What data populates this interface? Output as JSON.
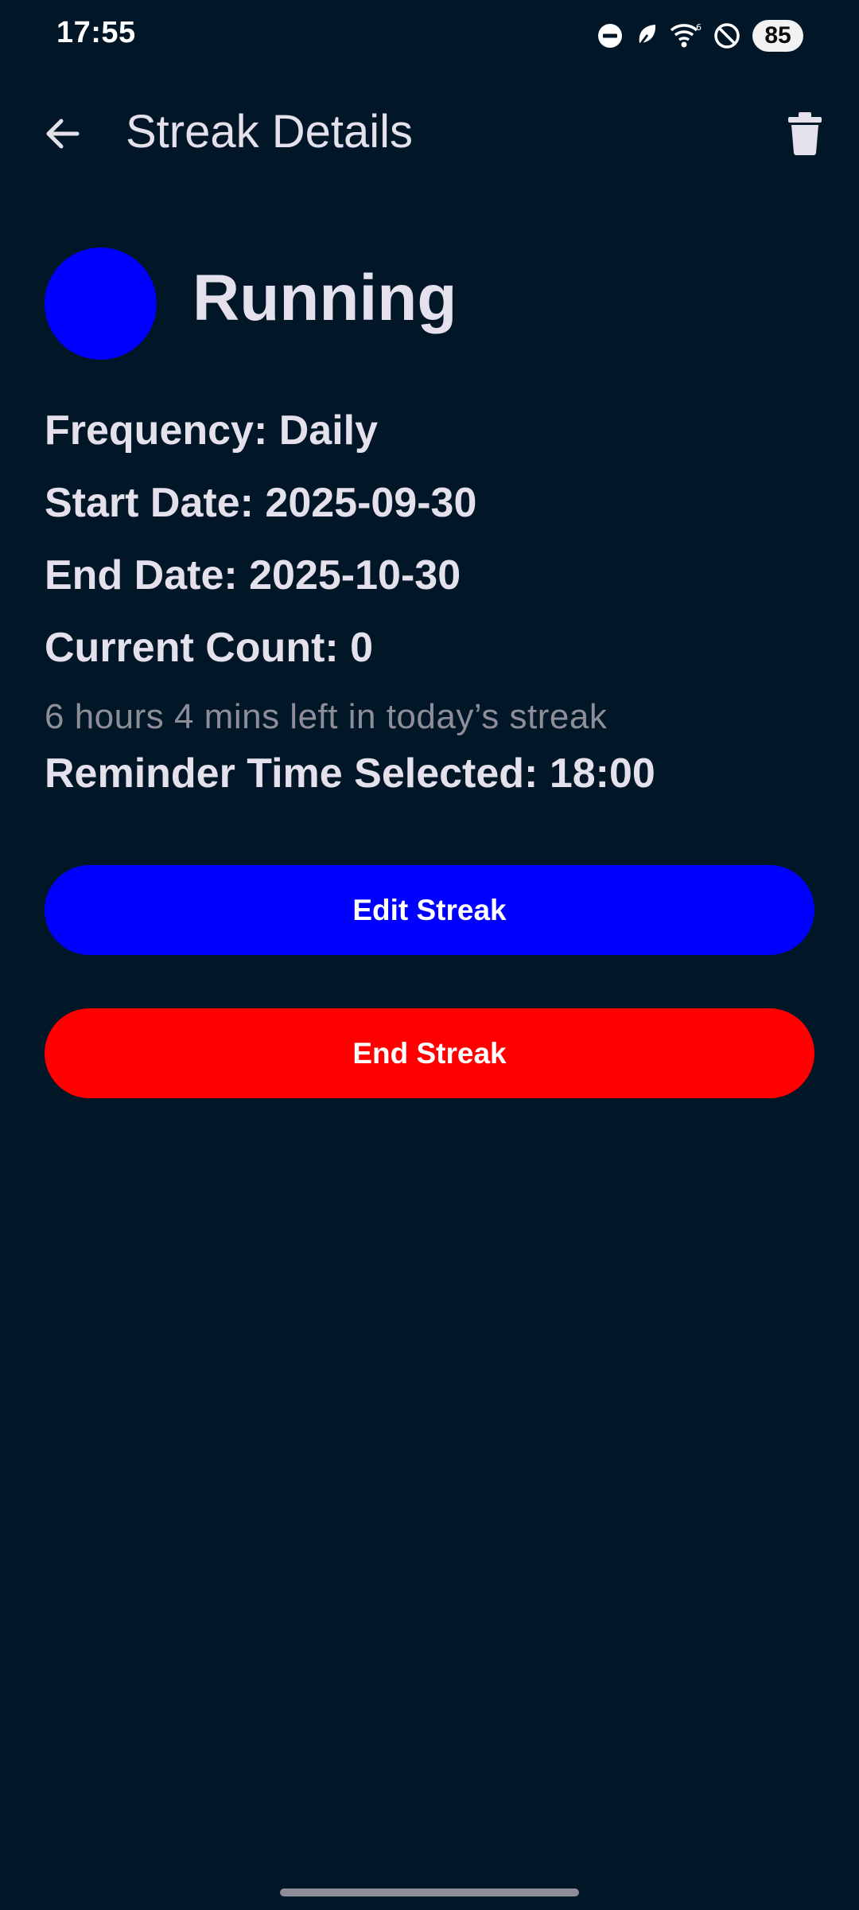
{
  "status_bar": {
    "time": "17:55",
    "battery_level": "85",
    "icons": [
      "dnd-icon",
      "leaf-icon",
      "wifi-icon",
      "no-sim-icon",
      "battery-icon"
    ]
  },
  "app_bar": {
    "title": "Streak Details",
    "back_icon": "arrow-back-icon",
    "delete_icon": "trash-icon"
  },
  "streak": {
    "name": "Running",
    "color": "#0000ff",
    "frequency": "Frequency: Daily",
    "start_date": "Start Date: 2025-09-30",
    "end_date": "End Date: 2025-10-30",
    "current_count": "Current Count: 0",
    "time_left": "6 hours 4 mins left in today’s streak",
    "reminder": "Reminder Time Selected: 18:00"
  },
  "actions": {
    "edit_label": "Edit Streak",
    "edit_color": "#0000ff",
    "end_label": "End Streak",
    "end_color": "#ff0000"
  },
  "theme": {
    "background": "#011627",
    "text": "#e4e1ec",
    "muted_text": "#8e8e99"
  }
}
